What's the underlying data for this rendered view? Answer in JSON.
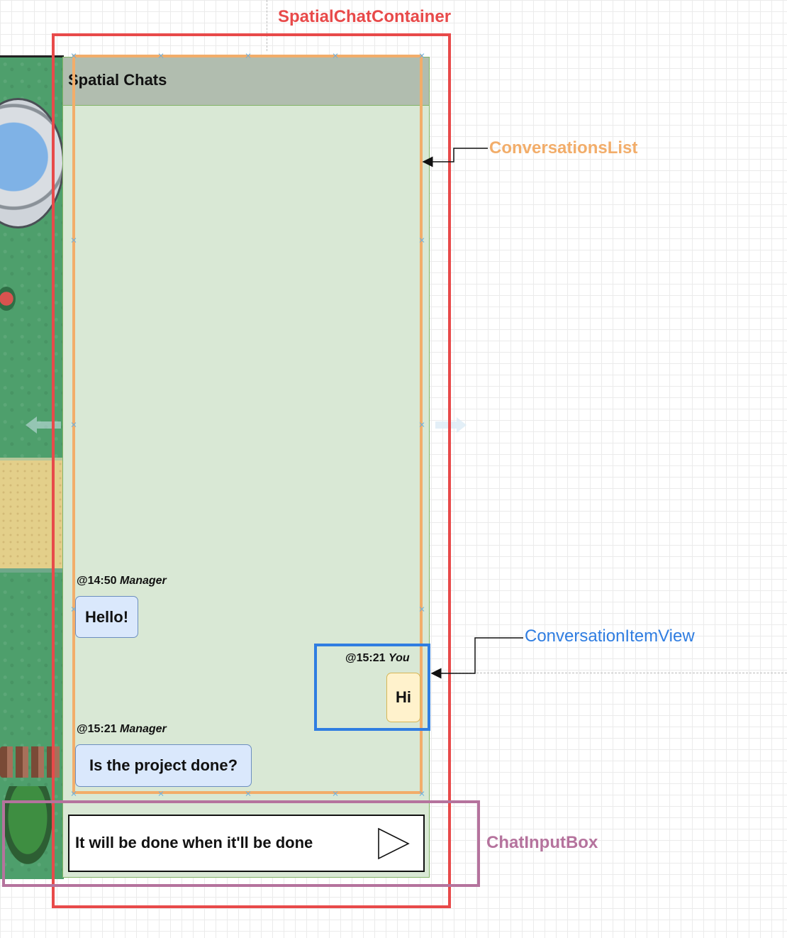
{
  "panel": {
    "title": "Spatial Chats"
  },
  "messages": [
    {
      "time": "@14:50",
      "author": "Manager",
      "text": "Hello!",
      "side": "left"
    },
    {
      "time": "@15:21",
      "author": "You",
      "text": "Hi",
      "side": "right"
    },
    {
      "time": "@15:21",
      "author": "Manager",
      "text": "Is the project done?",
      "side": "left"
    }
  ],
  "input": {
    "value": "It will be done when it'll be done",
    "send_icon": "send-triangle-icon"
  },
  "annotations": {
    "container": "SpatialChatContainer",
    "list": "ConversationsList",
    "item": "ConversationItemView",
    "input_box": "ChatInputBox"
  },
  "colors": {
    "container": "#e84a4a",
    "list": "#f2ad6a",
    "item": "#2f7de1",
    "input_box": "#b5739d",
    "panel_bg": "#d9e8d5",
    "header_bg": "#b1bdaf",
    "other_bubble": "#dae8fc",
    "self_bubble": "#fff2cc"
  }
}
